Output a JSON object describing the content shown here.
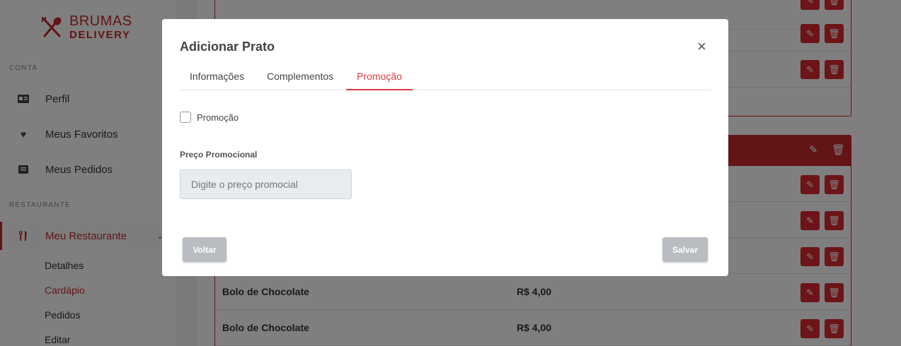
{
  "brand": {
    "line1": "BRUMAS",
    "line2": "DELIVERY"
  },
  "sidebar": {
    "section_account": "CONTA",
    "section_restaurant": "RESTAURANTE",
    "items": [
      {
        "label": "Perfil",
        "icon": "id-card-icon"
      },
      {
        "label": "Meus Favoritos",
        "icon": "heart-icon"
      },
      {
        "label": "Meus Pedidos",
        "icon": "list-icon"
      },
      {
        "label": "Meu Restaurante",
        "icon": "utensils-icon"
      }
    ],
    "sub_items": [
      {
        "label": "Detalhes"
      },
      {
        "label": "Cardápio"
      },
      {
        "label": "Pedidos"
      },
      {
        "label": "Editar"
      }
    ]
  },
  "menu_rows": [
    {
      "name": "Bolo de Chocolate",
      "price": "R$ 4,00"
    },
    {
      "name": "Bolo de Chocolate",
      "price": "R$ 4,00"
    }
  ],
  "modal": {
    "title": "Adicionar Prato",
    "tabs": [
      {
        "label": "Informações"
      },
      {
        "label": "Complementos"
      },
      {
        "label": "Promoção"
      }
    ],
    "active_tab": "Promoção",
    "checkbox_label": "Promoção",
    "checkbox_checked": false,
    "price_label": "Preço Promocional",
    "price_placeholder": "Digite o preço promocial",
    "back_button": "Voltar",
    "save_button": "Salvar"
  },
  "colors": {
    "accent": "#c4282d",
    "tab_active": "#e0393e",
    "disabled_button": "#b9bcc0"
  }
}
